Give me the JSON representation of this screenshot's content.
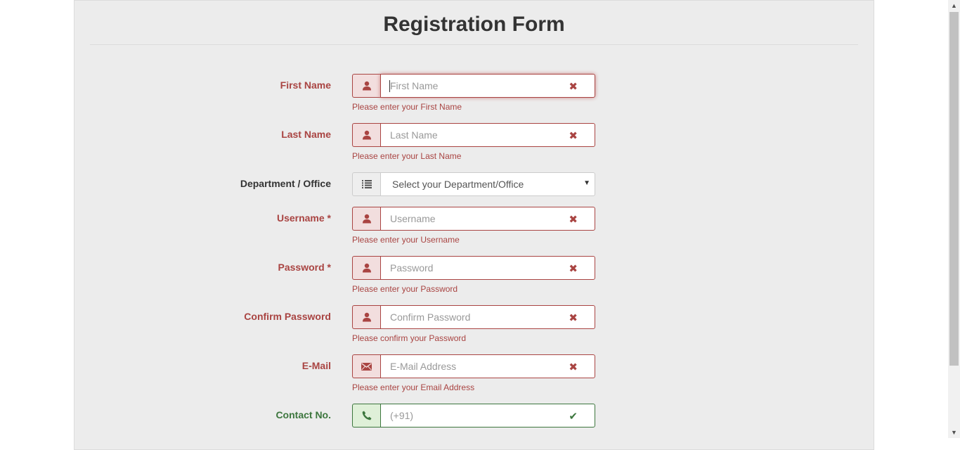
{
  "title": "Registration Form",
  "fields": [
    {
      "label": "First Name",
      "placeholder": "First Name",
      "help": "Please enter your First Name",
      "icon": "user-icon",
      "state": "error"
    },
    {
      "label": "Last Name",
      "placeholder": "Last Name",
      "help": "Please enter your Last Name",
      "icon": "user-icon",
      "state": "error"
    },
    {
      "label": "Department / Office",
      "placeholder": "Select your Department/Office",
      "help": "",
      "icon": "list-icon",
      "state": "neutral"
    },
    {
      "label": "Username *",
      "placeholder": "Username",
      "help": "Please enter your Username",
      "icon": "user-icon",
      "state": "error"
    },
    {
      "label": "Password *",
      "placeholder": "Password",
      "help": "Please enter your Password",
      "icon": "user-icon",
      "state": "error"
    },
    {
      "label": "Confirm Password",
      "placeholder": "Confirm Password",
      "help": "Please confirm your Password",
      "icon": "user-icon",
      "state": "error"
    },
    {
      "label": "E-Mail",
      "placeholder": "E-Mail Address",
      "help": "Please enter your Email Address",
      "icon": "envelope-icon",
      "state": "error"
    },
    {
      "label": "Contact No.",
      "placeholder": "(+91)",
      "help": "",
      "icon": "phone-icon",
      "state": "success"
    }
  ],
  "status_icons": {
    "error": "✖",
    "success": "✔"
  },
  "colors": {
    "error": "#a94442",
    "success": "#3c763d",
    "panel": "#ececec"
  }
}
